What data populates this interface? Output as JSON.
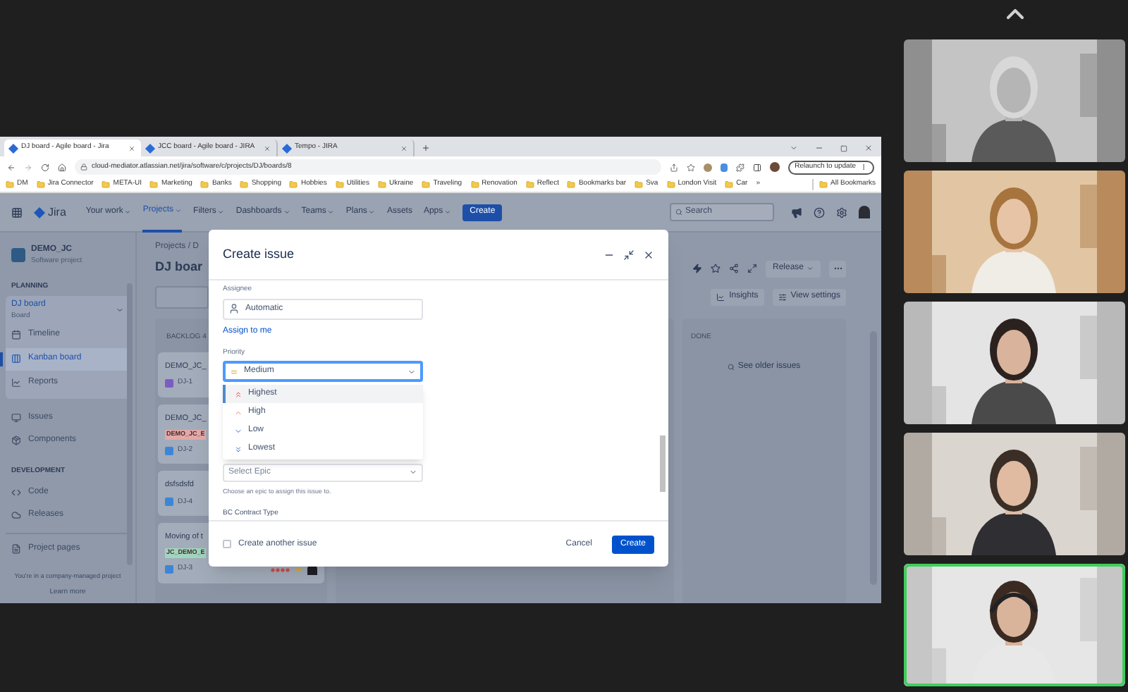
{
  "browser": {
    "tabs": [
      {
        "label": "DJ board - Agile board - Jira",
        "selected": true
      },
      {
        "label": "JCC board - Agile board - JIRA",
        "selected": false
      },
      {
        "label": "Tempo - JIRA",
        "selected": false
      }
    ],
    "url": "cloud-mediator.atlassian.net/jira/software/c/projects/DJ/boards/8",
    "relaunch_button": "Relaunch to update",
    "bookmarks": [
      "DM",
      "Jira Connector",
      "META-UI",
      "Marketing",
      "Banks",
      "Shopping",
      "Hobbies",
      "Utilities",
      "Ukraine",
      "Traveling",
      "Renovation",
      "Reflect",
      "Bookmarks bar",
      "Sva",
      "London Visit",
      "Car"
    ],
    "bookmarks_overflow": "»",
    "all_bookmarks": "All Bookmarks"
  },
  "jira_nav": {
    "logo": "Jira",
    "items": [
      {
        "label": "Your work",
        "menu": true,
        "selected": false
      },
      {
        "label": "Projects",
        "menu": true,
        "selected": true
      },
      {
        "label": "Filters",
        "menu": true,
        "selected": false
      },
      {
        "label": "Dashboards",
        "menu": true,
        "selected": false
      },
      {
        "label": "Teams",
        "menu": true,
        "selected": false
      },
      {
        "label": "Plans",
        "menu": true,
        "selected": false
      },
      {
        "label": "Assets",
        "menu": false,
        "selected": false
      },
      {
        "label": "Apps",
        "menu": true,
        "selected": false
      }
    ],
    "create_button": "Create",
    "search_placeholder": "Search"
  },
  "sidebar": {
    "project": "DEMO_JC",
    "project_type": "Software project",
    "sections": [
      {
        "heading": "PLANNING",
        "board": {
          "label": "DJ board",
          "sublabel": "Board",
          "expanded": true,
          "children": [
            {
              "label": "Timeline",
              "selected": false
            },
            {
              "label": "Kanban board",
              "selected": true
            },
            {
              "label": "Reports",
              "selected": false
            }
          ]
        },
        "items": [
          {
            "label": "Issues",
            "selected": false
          },
          {
            "label": "Components",
            "selected": false
          }
        ]
      },
      {
        "heading": "DEVELOPMENT",
        "items": [
          {
            "label": "Code",
            "selected": false
          },
          {
            "label": "Releases",
            "selected": false
          }
        ]
      }
    ],
    "project_pages": "Project pages",
    "footer": "You're in a company-managed project",
    "learn_more": "Learn more"
  },
  "board": {
    "breadcrumb": "Projects / D",
    "title": "DJ boar",
    "release_button": "Release",
    "insights_button": "Insights",
    "view_settings_button": "View settings",
    "backlog": {
      "title": "BACKLOG 4",
      "cards": [
        {
          "title": "DEMO_JC_",
          "key": "DJ-1",
          "kind": "epic"
        },
        {
          "title": "DEMO_JC_",
          "label": "DEMO_JC_E",
          "color": "#e3a9a9",
          "key": "DJ-2",
          "kind": "task"
        },
        {
          "title": "dsfsdsfd",
          "key": "DJ-4",
          "kind": "task"
        },
        {
          "title": "Moving of t",
          "label": "JC_DEMO_E",
          "color": "#9fd6bd",
          "key": "DJ-3",
          "kind": "estimated"
        }
      ]
    },
    "done": {
      "title": "DONE",
      "link": "See older issues"
    }
  },
  "modal": {
    "title": "Create issue",
    "assignee": {
      "label": "Assignee",
      "value": "Automatic"
    },
    "assign_link": "Assign to me",
    "priority": {
      "label": "Priority",
      "value": "Medium",
      "options": [
        {
          "label": "Highest",
          "selected": true
        },
        {
          "label": "High",
          "selected": false
        },
        {
          "label": "Low",
          "selected": false
        },
        {
          "label": "Lowest",
          "selected": false
        }
      ]
    },
    "epic": {
      "placeholder": "Select Epic",
      "helper": "Choose an epic to assign this issue to."
    },
    "next_field": "BC Contract Type",
    "create_another": {
      "label": "Create another issue",
      "checked": false
    },
    "cancel_button": "Cancel",
    "create_button": "Create"
  },
  "videos": [
    {
      "kind": "picture",
      "speaking": false
    },
    {
      "kind": "picture",
      "speaking": false
    },
    {
      "kind": "picture",
      "speaking": false
    },
    {
      "kind": "picture",
      "speaking": false
    },
    {
      "kind": "picture",
      "speaking": true
    }
  ]
}
